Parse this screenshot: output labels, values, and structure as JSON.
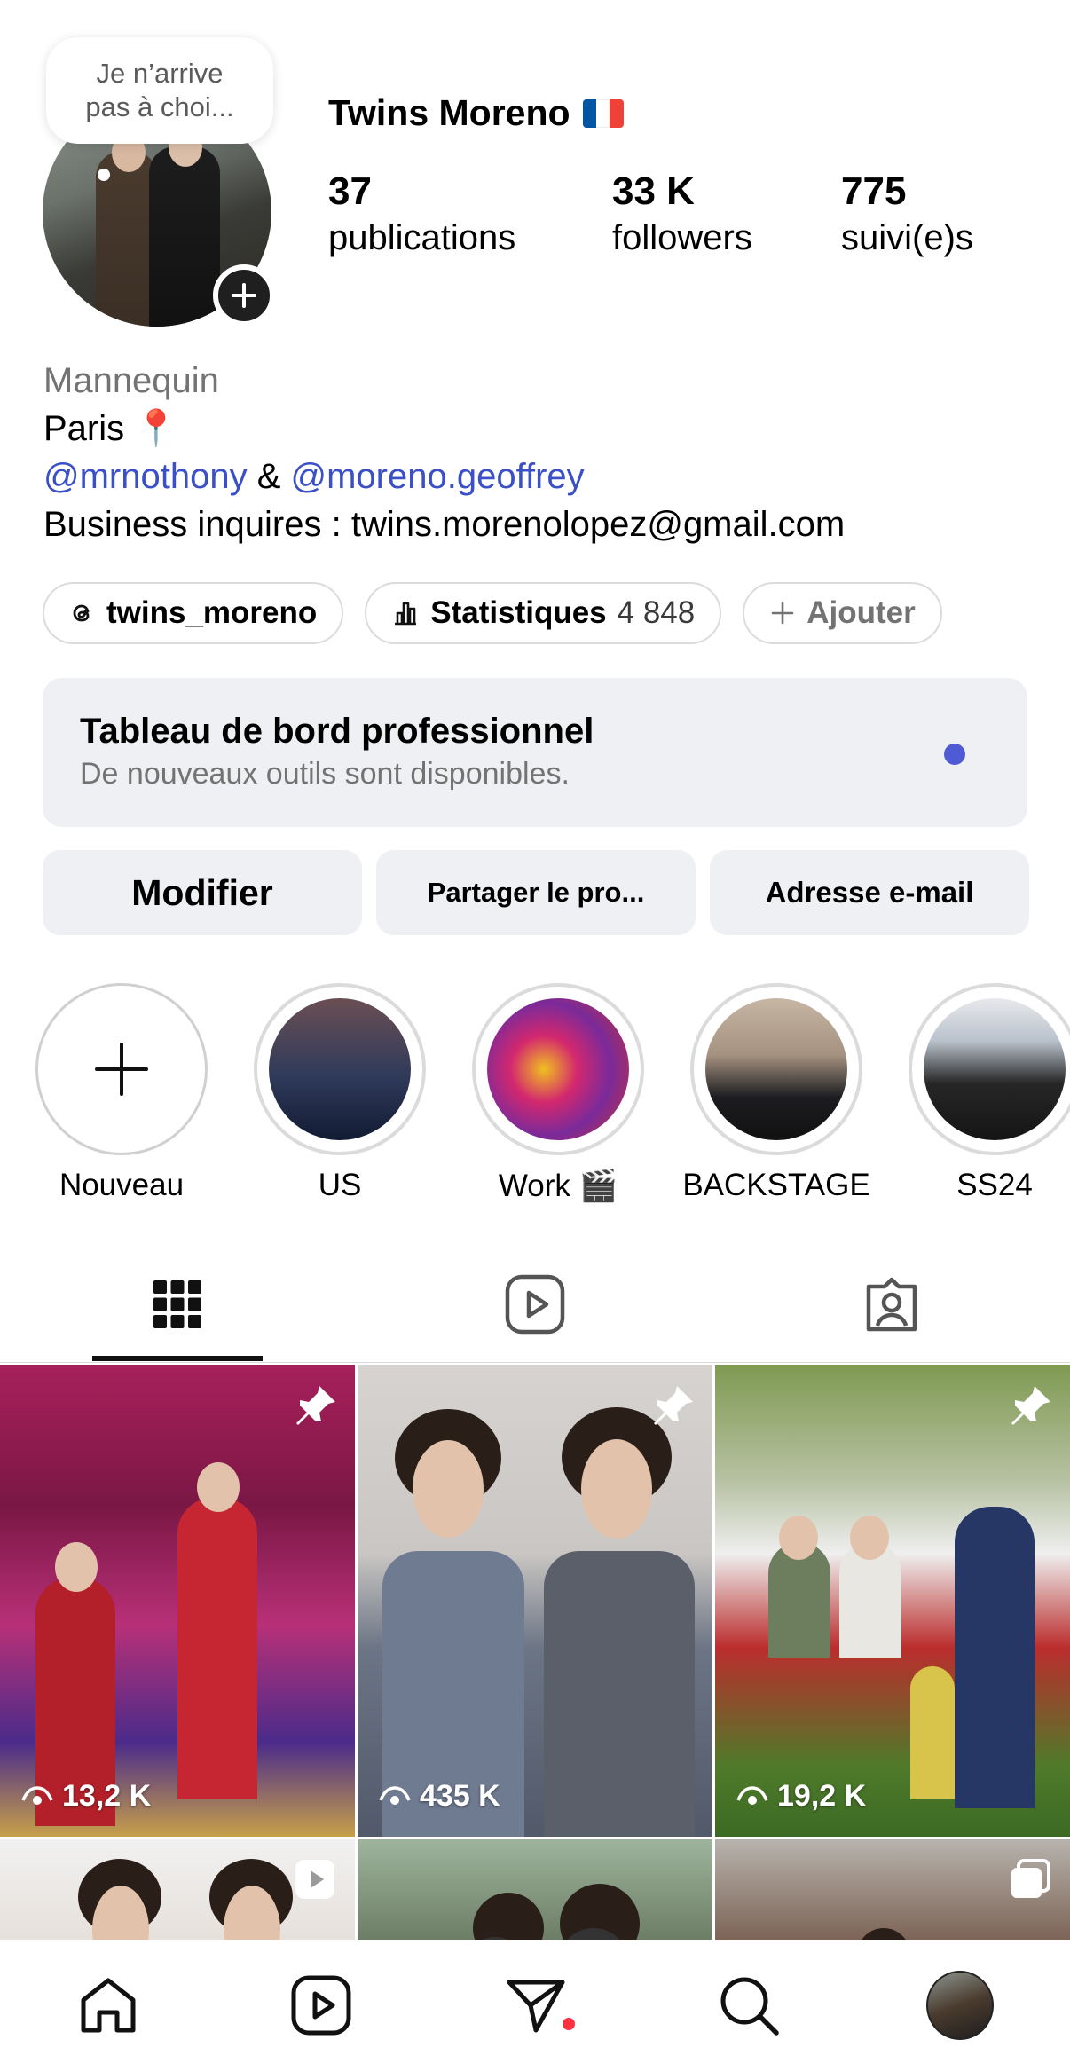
{
  "profile": {
    "name": "Twins Moreno",
    "note_bubble_line1": "Je n’arrive",
    "note_bubble_line2": "pas à choi...",
    "stats": [
      {
        "value": "37",
        "label": "publications"
      },
      {
        "value": "33 K",
        "label": "followers"
      },
      {
        "value": "775",
        "label": "suivi(e)s"
      }
    ],
    "flag_colors": [
      "#0055a4",
      "#ffffff",
      "#ef4135"
    ]
  },
  "bio": {
    "category": "Mannequin",
    "city": "Paris",
    "city_emoji": "📍",
    "mention1": "@mrnothony",
    "ampersand": " & ",
    "mention2": "@moreno.geoffrey",
    "business": "Business inquires : twins.morenolopez@gmail.com",
    "link_color": "#3b50c6"
  },
  "chips": {
    "threads": "twins_moreno",
    "stats_label": "Statistiques",
    "stats_value": "4 848",
    "add": "Ajouter"
  },
  "dashboard": {
    "title": "Tableau de bord professionnel",
    "subtitle": "De nouveaux outils sont disponibles."
  },
  "actions": {
    "edit": "Modifier",
    "share": "Partager le pro...",
    "email": "Adresse e-mail"
  },
  "highlights": [
    {
      "label": "Nouveau"
    },
    {
      "label": "US"
    },
    {
      "label": "Work 🎬"
    },
    {
      "label": "BACKSTAGE"
    },
    {
      "label": "SS24"
    }
  ],
  "tabs": {
    "active": "grid-icon",
    "items": [
      "grid-icon",
      "reels-icon",
      "tagged-icon"
    ]
  },
  "posts": [
    {
      "views": "13,2 K",
      "pinned": true
    },
    {
      "views": "435 K",
      "pinned": true
    },
    {
      "views": "19,2 K",
      "pinned": true
    },
    {
      "type": "reel"
    },
    {
      "type": "photo"
    },
    {
      "type": "carousel"
    }
  ],
  "bottom_nav": [
    "home-icon",
    "reels-icon",
    "messages-icon",
    "search-icon",
    "profile-avatar"
  ]
}
